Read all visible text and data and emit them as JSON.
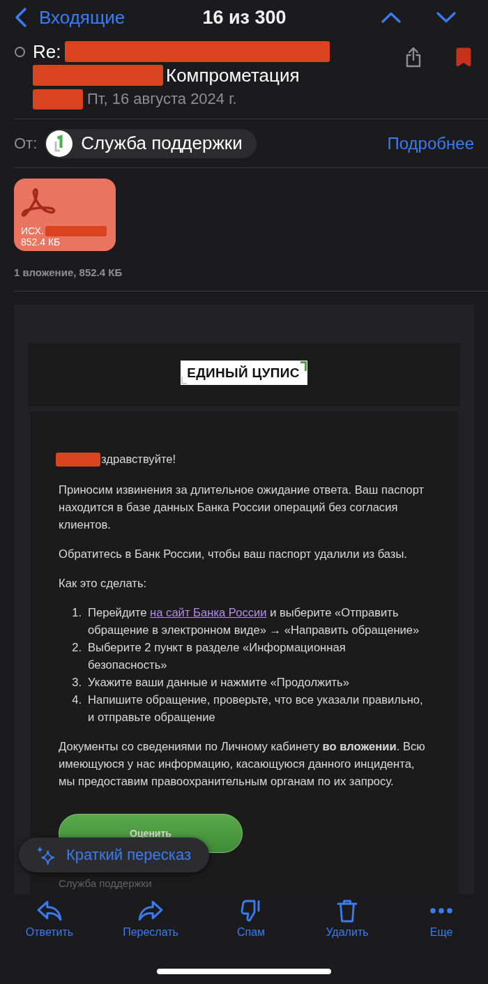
{
  "nav": {
    "back_label": "Входящие",
    "position": "16 из 300"
  },
  "message": {
    "unread": false,
    "flagged": true,
    "subject": [
      {
        "kind": "text",
        "text": "Re:"
      },
      {
        "kind": "redacted"
      },
      {
        "kind": "redacted"
      },
      {
        "kind": "text",
        "text": "Компрометация"
      }
    ],
    "date_line": [
      {
        "kind": "redacted"
      },
      {
        "kind": "text",
        "text": "Пт, 16 августа 2024 г."
      }
    ],
    "from": {
      "label": "От:",
      "sender": "Служба поддержки",
      "details_link": "Подробнее"
    }
  },
  "attachments": [
    {
      "name": [
        {
          "kind": "text",
          "text": "ИСХ."
        },
        {
          "kind": "redacted"
        }
      ],
      "size": "852.4 КБ"
    }
  ],
  "attachments_summary": "1 вложение, 852.4 КБ",
  "body": {
    "logo_text": "ЕДИНЫЙ ЦУПИС",
    "greeting": [
      {
        "kind": "redacted"
      },
      {
        "kind": "text",
        "text": "здравствуйте!"
      }
    ],
    "paragraphs": [
      "Приносим извинения за длительное ожидание ответа. Ваш паспорт находится в базе данных Банка России операций без согласия клиентов.",
      "Обратитесь в Банк России, чтобы ваш паспорт удалили из базы.",
      "Как это сделать:"
    ],
    "steps": [
      {
        "number": "1.",
        "parts": [
          {
            "kind": "text",
            "text": "Перейдите "
          },
          {
            "kind": "link",
            "text": "на сайт Банка России"
          },
          {
            "kind": "text",
            "text": " и выберите «Отправить обращение в электронном виде» → «Направить обращение»"
          }
        ]
      },
      {
        "number": "2.",
        "parts": [
          {
            "kind": "text",
            "text": "Выберите 2 пункт в разделе «Информационная безопасность»"
          }
        ]
      },
      {
        "number": "3.",
        "parts": [
          {
            "kind": "text",
            "text": "Укажите ваши данные и нажмите «Продолжить»"
          }
        ]
      },
      {
        "number": "4.",
        "parts": [
          {
            "kind": "text",
            "text": "Напишите обращение, проверьте, что все указали правильно, и отправьте обращение"
          }
        ]
      }
    ],
    "closing": "Документы со сведениями по Личному кабинету **во вложении**. Всю имеющуюся у нас информацию, касающуюся данного инцидента, мы предоставим правоохранительным органам по их запросу.",
    "button": "Оценить",
    "signature": "Служба поддержки"
  },
  "summary_button": "Краткий пересказ",
  "toolbar": [
    {
      "kind": "reply",
      "label": "Ответить"
    },
    {
      "kind": "forward",
      "label": "Переслать"
    },
    {
      "kind": "spam",
      "label": "Спам"
    },
    {
      "kind": "delete",
      "label": "Удалить"
    },
    {
      "kind": "more",
      "label": "Еще"
    }
  ]
}
